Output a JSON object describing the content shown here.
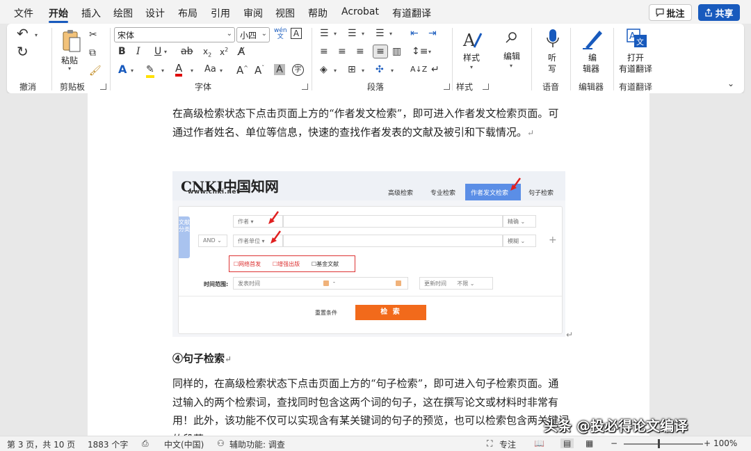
{
  "menu": {
    "items": [
      "文件",
      "开始",
      "插入",
      "绘图",
      "设计",
      "布局",
      "引用",
      "审阅",
      "视图",
      "帮助",
      "Acrobat",
      "有道翻译"
    ],
    "comment_label": "批注",
    "share_label": "共享"
  },
  "ribbon": {
    "undo_group": "撤消",
    "clipboard": {
      "paste": "粘贴",
      "group": "剪贴板"
    },
    "font": {
      "name": "宋体",
      "size": "小四",
      "group": "字体"
    },
    "paragraph_group": "段落",
    "styles": {
      "label": "样式",
      "group": "样式"
    },
    "editing": {
      "label": "编辑"
    },
    "voice": {
      "label1": "听",
      "label2": "写",
      "group": "语音"
    },
    "editor": {
      "label1": "编",
      "label2": "辑器",
      "group": "编辑器"
    },
    "youdao": {
      "label1": "打开",
      "label2": "有道翻译",
      "group": "有道翻译"
    }
  },
  "document": {
    "para1": "在高级检索状态下点击页面上方的“作者发文检索”，即可进入作者发文检索页面。可通过作者姓名、单位等信息，快速的查找作者发表的文献及被引和下载情况。",
    "heading": "④句子检索",
    "para2": "同样的，在高级检索状态下点击页面上方的“句子检索”，即可进入句子检索页面。通过输入的两个检索词，查找同时包含这两个词的句子，这在撰写论文或材料时非常有用！此外，该功能不仅可以实现含有某关键词的句子的预览，也可以检索包含两关键词的段落。",
    "para_mark": "↵"
  },
  "cnki": {
    "logo": "CNKI中国知网",
    "url": "www.cnki.net",
    "tabs": [
      "高级检索",
      "专业检索",
      "作者发文检索",
      "句子检索"
    ],
    "active_tab": "作者发文检索",
    "side_tab": "文献分类",
    "field_author": "作者",
    "match_exact": "精确",
    "logic": "AND",
    "field_unit": "作者单位",
    "match_fuzzy": "模糊",
    "checkboxes": [
      "网络首发",
      "增强出版",
      "基金文献"
    ],
    "time_label": "时间范围:",
    "publish_time": "发表时间",
    "range_sep": "-",
    "update_time": "更新时间",
    "unlimited": "不限",
    "reset": "重置条件",
    "search": "检 索"
  },
  "watermark": "头条 @投必得论文编译",
  "status": {
    "page": "第 3 页，共 10 页",
    "words": "1883 个字",
    "language": "中文(中国)",
    "accessibility": "辅助功能: 调查",
    "focus": "专注",
    "zoom": "100%"
  }
}
